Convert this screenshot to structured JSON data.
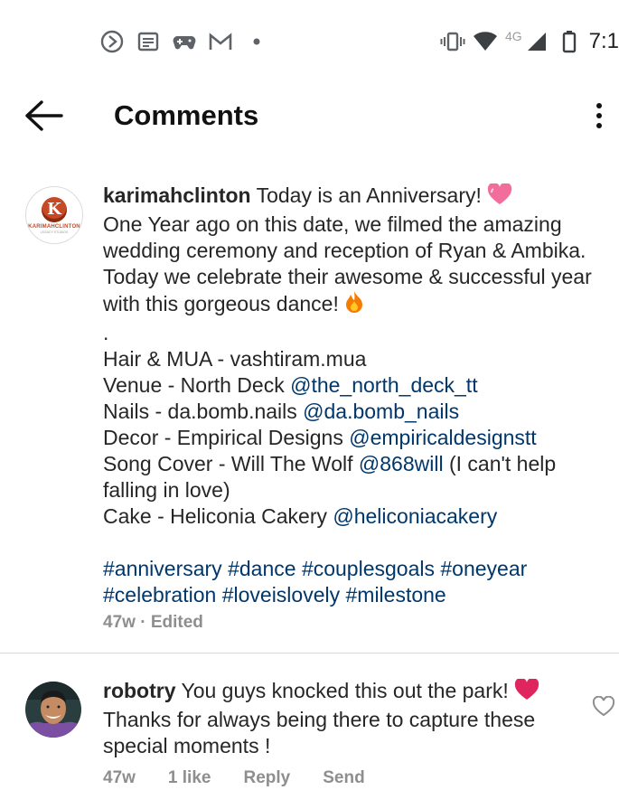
{
  "status_bar": {
    "time": "7:1",
    "network": "4G",
    "left_icons": [
      "media-play-icon",
      "news-icon",
      "game-controller-icon",
      "gmail-icon",
      "dot-icon"
    ],
    "right_icons": [
      "vibrate-icon",
      "wifi-icon",
      "cell-signal-icon",
      "battery-icon"
    ]
  },
  "header": {
    "title": "Comments",
    "back_icon": "arrow-left-icon",
    "more_icon": "more-vertical-icon"
  },
  "caption": {
    "username": "karimahclinton",
    "avatar_brand": "KARIMAHCLINTON",
    "avatar_tagline": "LEGACY STUDIOS",
    "avatar_letter": "K",
    "first_line": "Today is an Anniversary!",
    "body_1": "One Year ago on this date, we filmed the amazing wedding ceremony and reception of Ryan & Ambika. Today we celebrate their awesome & successful year with this gorgeous dance!",
    "dot": ".",
    "credits": [
      {
        "text": "Hair & MUA - vashtiram.mua",
        "mention": "",
        "tail": ""
      },
      {
        "text": "Venue - North Deck ",
        "mention": "@the_north_deck_tt",
        "tail": ""
      },
      {
        "text": "Nails - da.bomb.nails ",
        "mention": "@da.bomb_nails",
        "tail": ""
      },
      {
        "text": "Decor - Empirical Designs ",
        "mention": "@empiricaldesignstt",
        "tail": ""
      },
      {
        "text": "Song Cover - Will The Wolf ",
        "mention": "@868will",
        "tail": " (I can't help falling in love)"
      },
      {
        "text": "Cake - Heliconia Cakery ",
        "mention": "@heliconiacakery",
        "tail": ""
      }
    ],
    "hashtags": [
      "#anniversary",
      "#dance",
      "#couplesgoals",
      "#oneyear",
      "#celebration",
      "#loveislovely",
      "#milestone"
    ],
    "time": "47w",
    "edited": "Edited",
    "separator": "·"
  },
  "reply": {
    "username": "robotry",
    "text_1": "You guys knocked this out the park!",
    "text_2": "Thanks for always being there to capture these special moments !",
    "time": "47w",
    "likes": "1 like",
    "reply_label": "Reply",
    "send_label": "Send",
    "like_icon": "heart-outline-icon"
  },
  "colors": {
    "mention": "#00376b",
    "meta": "#8e8e8e",
    "brand": "#c64a25"
  }
}
